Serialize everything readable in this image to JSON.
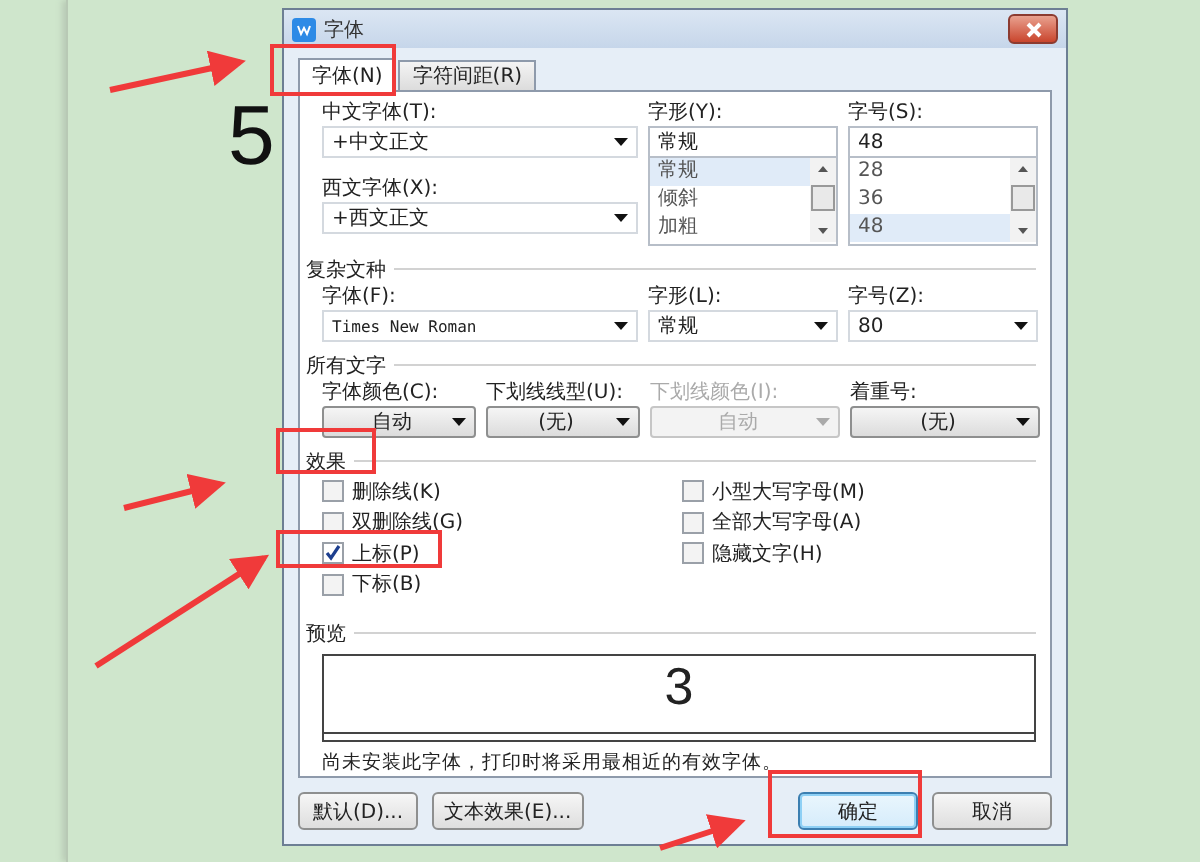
{
  "document": {
    "text": "5"
  },
  "dialog": {
    "title": "字体",
    "tabs": [
      {
        "label": "字体(N)",
        "selected": true
      },
      {
        "label": "字符间距(R)",
        "selected": false
      }
    ],
    "chinese_font": {
      "label": "中文字体(T):",
      "value": "+中文正文"
    },
    "style": {
      "label": "字形(Y):",
      "value": "常规",
      "options": [
        {
          "label": "常规",
          "selected": true
        },
        {
          "label": "倾斜",
          "selected": false
        },
        {
          "label": "加粗",
          "selected": false
        }
      ]
    },
    "size": {
      "label": "字号(S):",
      "value": "48",
      "options": [
        {
          "label": "28",
          "selected": false
        },
        {
          "label": "36",
          "selected": false
        },
        {
          "label": "48",
          "selected": true
        }
      ]
    },
    "western_font": {
      "label": "西文字体(X):",
      "value": "+西文正文"
    },
    "complex_script": {
      "heading": "复杂文种",
      "fields": [
        {
          "label": "字体(F):",
          "value": "Times New Roman"
        },
        {
          "label": "字形(L):",
          "value": "常规"
        },
        {
          "label": "字号(Z):",
          "value": "80"
        }
      ]
    },
    "all_text": {
      "heading": "所有文字",
      "fields": [
        {
          "label": "字体颜色(C):",
          "value": "自动",
          "disabled": false
        },
        {
          "label": "下划线线型(U):",
          "value": "(无)",
          "disabled": false
        },
        {
          "label": "下划线颜色(I):",
          "value": "自动",
          "disabled": true
        },
        {
          "label": "着重号:",
          "value": "(无)",
          "disabled": false
        }
      ]
    },
    "effects": {
      "heading": "效果",
      "left": [
        {
          "label": "删除线(K)",
          "checked": false
        },
        {
          "label": "双删除线(G)",
          "checked": false
        },
        {
          "label": "上标(P)",
          "checked": true
        },
        {
          "label": "下标(B)",
          "checked": false
        }
      ],
      "right": [
        {
          "label": "小型大写字母(M)",
          "checked": false
        },
        {
          "label": "全部大写字母(A)",
          "checked": false
        },
        {
          "label": "隐藏文字(H)",
          "checked": false
        }
      ]
    },
    "preview": {
      "heading": "预览",
      "sample": "3"
    },
    "note": "尚未安装此字体，打印时将采用最相近的有效字体。",
    "buttons": [
      {
        "label": "默认(D)...",
        "default": false
      },
      {
        "label": "文本效果(E)...",
        "default": false
      },
      {
        "label": "确定",
        "default": true
      },
      {
        "label": "取消",
        "default": false
      }
    ]
  }
}
